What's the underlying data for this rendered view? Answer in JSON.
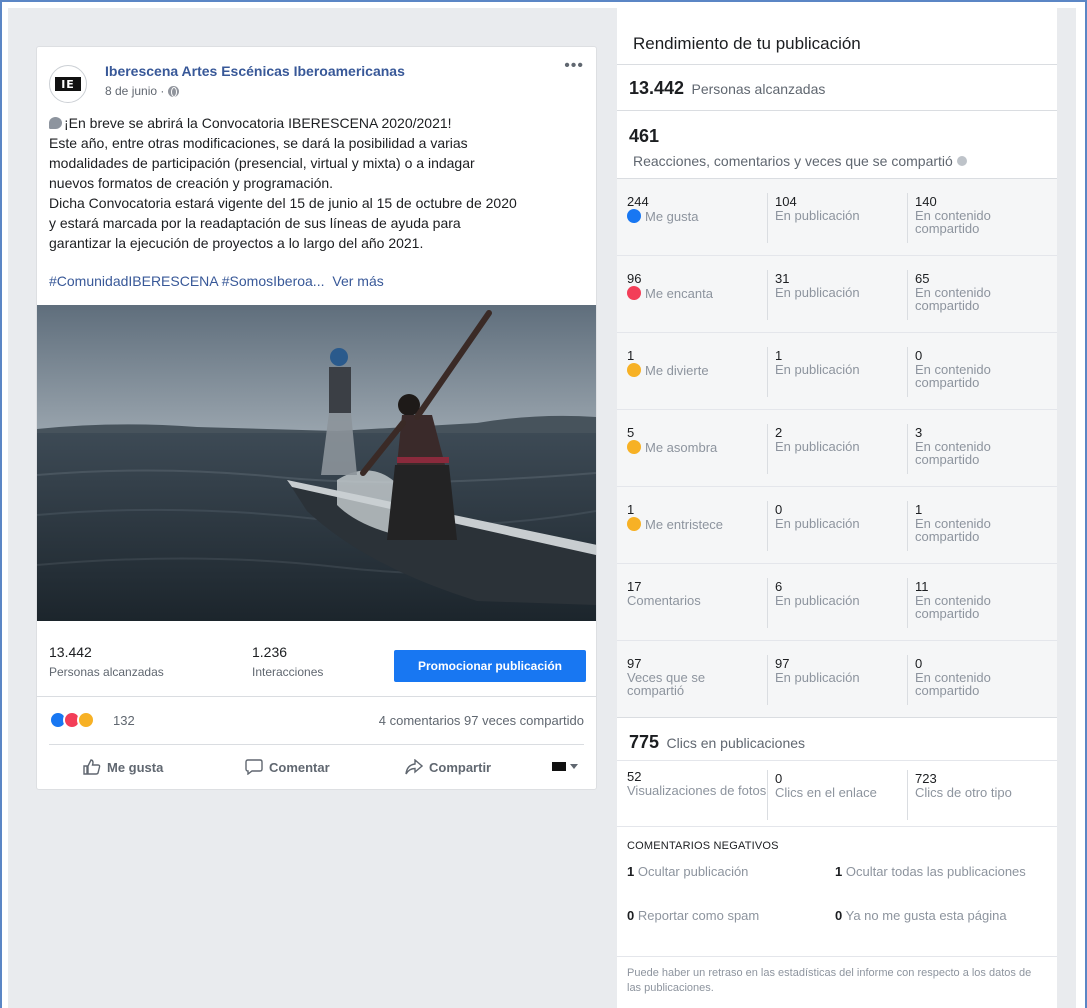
{
  "post": {
    "page_name": "Iberescena Artes Escénicas Iberoamericanas",
    "logo_text": "IE",
    "date": "8 de junio ·",
    "text_lines": [
      "¡En breve se abrirá la Convocatoria IBERESCENA 2020/2021!",
      "Este año, entre otras modificaciones, se dará la posibilidad a varias",
      "modalidades de participación (presencial, virtual y mixta) o a indagar",
      "nuevos formatos de creación y programación.",
      "Dicha Convocatoria estará vigente del 15 de junio al 15 de octubre de 2020",
      "y estará marcada por la readaptación de sus líneas de ayuda para",
      "garantizar la ejecución de proyectos a lo largo del año 2021."
    ],
    "hashtags": "#ComunidadIBERESCENA #SomosIberoa...",
    "see_more": "Ver más",
    "reach_value": "13.442",
    "reach_label": "Personas alcanzadas",
    "interactions_value": "1.236",
    "interactions_label": "Interacciones",
    "promote_label": "Promocionar publicación",
    "reaction_count": "132",
    "comments_shares": "4 comentarios  97 veces compartido",
    "actions": {
      "like": "Me gusta",
      "comment": "Comentar",
      "share": "Compartir"
    }
  },
  "panel": {
    "title": "Rendimiento de tu publicación",
    "reach_value": "13.442",
    "reach_label": "Personas alcanzadas",
    "reactions_value": "461",
    "reactions_label": "Reacciones, comentarios y veces que se compartió",
    "rows": [
      {
        "total": "244",
        "label": "Me gusta",
        "icon": "like-emoji",
        "on_post": "104",
        "on_post_label": "En publicación",
        "on_shares": "140",
        "on_shares_label": "En contenido compartido"
      },
      {
        "total": "96",
        "label": "Me encanta",
        "icon": "love-emoji",
        "on_post": "31",
        "on_post_label": "En publicación",
        "on_shares": "65",
        "on_shares_label": "En contenido compartido"
      },
      {
        "total": "1",
        "label": "Me divierte",
        "icon": "haha-emoji",
        "on_post": "1",
        "on_post_label": "En publicación",
        "on_shares": "0",
        "on_shares_label": "En contenido compartido"
      },
      {
        "total": "5",
        "label": "Me asombra",
        "icon": "wow-emoji",
        "on_post": "2",
        "on_post_label": "En publicación",
        "on_shares": "3",
        "on_shares_label": "En contenido compartido"
      },
      {
        "total": "1",
        "label": "Me entristece",
        "icon": "sad-emoji",
        "on_post": "0",
        "on_post_label": "En publicación",
        "on_shares": "1",
        "on_shares_label": "En contenido compartido"
      },
      {
        "total": "17",
        "label": "Comentarios",
        "icon": "",
        "on_post": "6",
        "on_post_label": "En publicación",
        "on_shares": "11",
        "on_shares_label": "En contenido compartido"
      },
      {
        "total": "97",
        "label": "Veces que se compartió",
        "icon": "",
        "on_post": "97",
        "on_post_label": "En publicación",
        "on_shares": "0",
        "on_shares_label": "En contenido compartido"
      }
    ],
    "clicks_value": "775",
    "clicks_label": "Clics en publicaciones",
    "clicks": [
      {
        "value": "52",
        "label": "Visualizaciones de fotos"
      },
      {
        "value": "0",
        "label": "Clics en el enlace"
      },
      {
        "value": "723",
        "label": "Clics de otro tipo"
      }
    ],
    "negative_title": "COMENTARIOS NEGATIVOS",
    "negative": [
      {
        "value": "1",
        "label": "Ocultar publicación"
      },
      {
        "value": "1",
        "label": "Ocultar todas las publicaciones"
      },
      {
        "value": "0",
        "label": "Reportar como spam"
      },
      {
        "value": "0",
        "label": "Ya no me gusta esta página"
      }
    ],
    "footnote": "Puede haber un retraso en las estadísticas del informe con respecto a los datos de las publicaciones."
  },
  "colors": {
    "brand_blue": "#1877f2",
    "link_blue": "#385898",
    "love_red": "#f33e58",
    "emoji_yellow": "#f7b125"
  }
}
